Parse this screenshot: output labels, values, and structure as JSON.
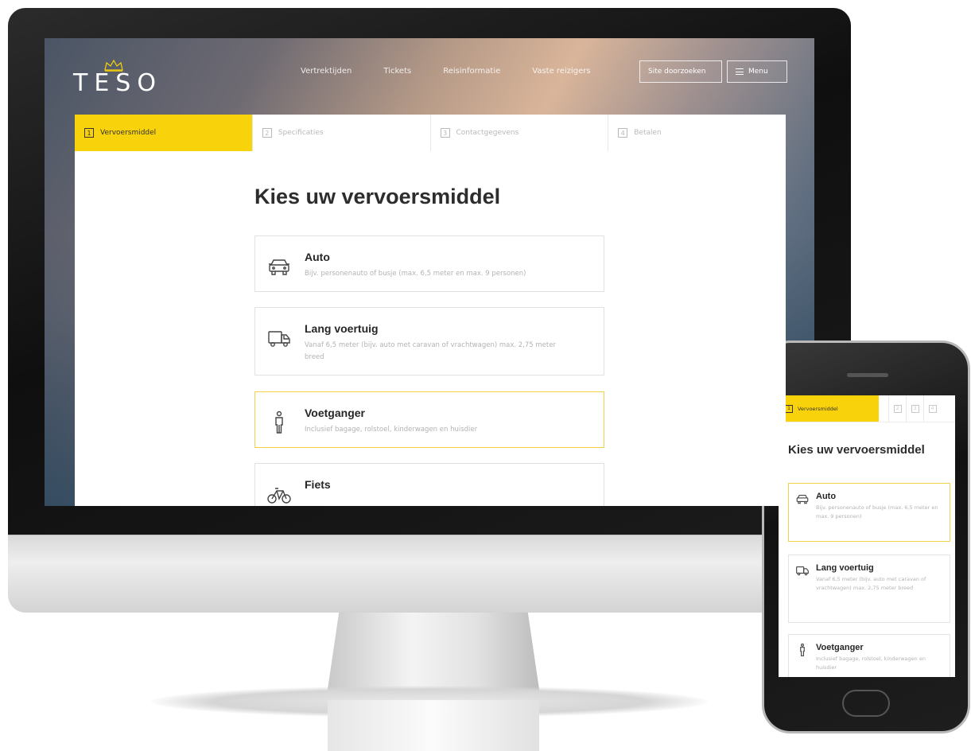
{
  "site": {
    "logo_text": "TESO"
  },
  "nav": {
    "links": [
      "Vertrektijden",
      "Tickets",
      "Reisinformatie",
      "Vaste reizigers"
    ],
    "sitemap_label": "Site doorzoeken",
    "menu_label": "Menu"
  },
  "steps": [
    {
      "number": "1",
      "label": "Vervoersmiddel"
    },
    {
      "number": "2",
      "label": "Specificaties"
    },
    {
      "number": "3",
      "label": "Contactgegevens"
    },
    {
      "number": "4",
      "label": "Betalen"
    }
  ],
  "main": {
    "title": "Kies uw vervoersmiddel",
    "options": [
      {
        "name": "Auto",
        "description": "Bijv. personenauto of busje (max. 6,5 meter en max. 9 personen)",
        "icon": "car-icon"
      },
      {
        "name": "Lang voertuig",
        "description": "Vanaf 6,5 meter (bijv. auto met caravan of vrachtwagen) max. 2,75 meter breed",
        "icon": "truck-icon"
      },
      {
        "name": "Voetganger",
        "description": "Inclusief bagage, rolstoel, kinderwagen en huisdier",
        "icon": "pedestrian-icon"
      },
      {
        "name": "Fiets",
        "description": "",
        "icon": "bicycle-icon"
      }
    ]
  },
  "mobile": {
    "active_step_number": "1",
    "active_step_label": "Vervoersmiddel",
    "other_step_numbers": [
      "2",
      "3",
      "4"
    ],
    "title": "Kies uw vervoersmiddel",
    "options": [
      {
        "name": "Auto",
        "description": "Bijv. personenauto of busje (max. 6,5 meter en max. 9 personen)"
      },
      {
        "name": "Lang voertuig",
        "description": "Vanaf 6,5 meter (bijv. auto met caravan of vrachtwagen) max. 2,75 meter breed"
      },
      {
        "name": "Voetganger",
        "description": "Inclusief bagage, rolstoel, kinderwagen en huisdier"
      }
    ]
  },
  "colors": {
    "accent": "#f8d20a",
    "selected_border": "#f2d04a"
  }
}
